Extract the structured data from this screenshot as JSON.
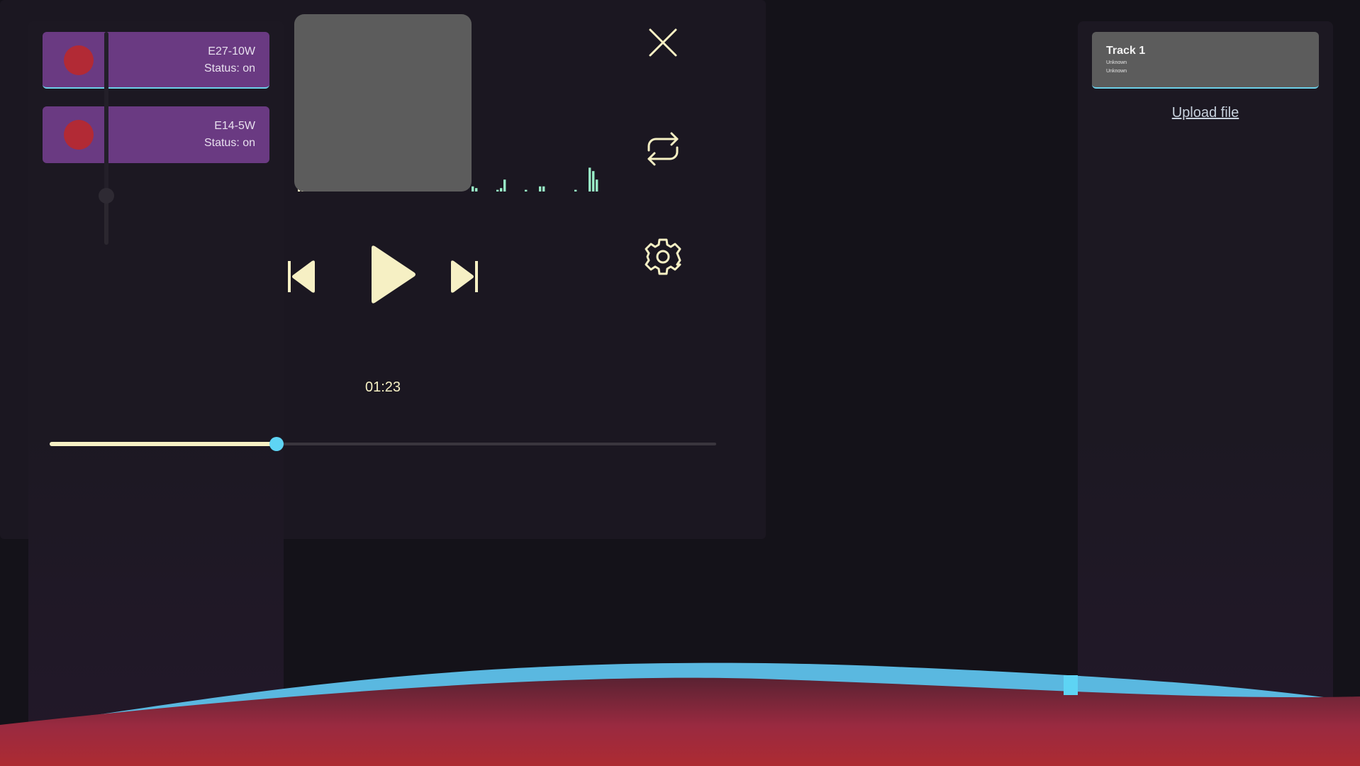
{
  "devices": [
    {
      "name": "E27-10W",
      "status": "Status: on"
    },
    {
      "name": "E14-5W",
      "status": "Status: on"
    }
  ],
  "playlist": {
    "tracks": [
      {
        "title": "Track 1",
        "artist": "Unknown",
        "album": "Unknown"
      }
    ],
    "upload_label": "Upload file"
  },
  "player": {
    "time": "01:23",
    "progress": 0.34,
    "volume": 0.23,
    "icons": {
      "close": "close-icon",
      "repeat": "repeat-icon",
      "settings": "gear-icon",
      "previous": "skip-previous-icon",
      "play": "play-icon",
      "next": "skip-next-icon"
    }
  },
  "spectrum": {
    "levels": [
      1.0,
      0.48,
      0.53,
      0.25,
      0.1,
      0.21,
      0.18,
      0,
      0,
      0.04,
      0.27,
      0.12,
      0.05,
      0.1,
      0.29,
      0.04,
      0.02,
      0,
      0,
      0.05,
      0,
      0,
      0,
      0.18,
      0.19,
      0,
      0,
      0,
      0,
      0.01,
      0.11,
      0.17,
      0.03,
      0.02,
      0.04,
      0,
      0.02,
      0.03,
      0,
      0,
      0,
      0,
      0.06,
      0.05,
      0,
      0,
      0,
      0,
      0,
      0.03,
      0.02,
      0,
      0,
      0,
      0,
      0,
      0.01,
      0.02,
      0.07,
      0,
      0,
      0,
      0,
      0,
      0.01,
      0,
      0,
      0,
      0.03,
      0.03,
      0,
      0,
      0,
      0,
      0,
      0,
      0,
      0,
      0.01,
      0,
      0,
      0,
      0.14,
      0.12,
      0.07
    ],
    "colors": {
      "high": "#f6f0c4",
      "low": "#98eec6"
    }
  },
  "colors": {
    "accent": "#5ed4f4",
    "text": "#f6f0c4",
    "device_card": "#6a3a82",
    "device_indicator": "#b22a35",
    "wave_red": "#a82c3c",
    "wave_blue": "#5ab8e0"
  }
}
